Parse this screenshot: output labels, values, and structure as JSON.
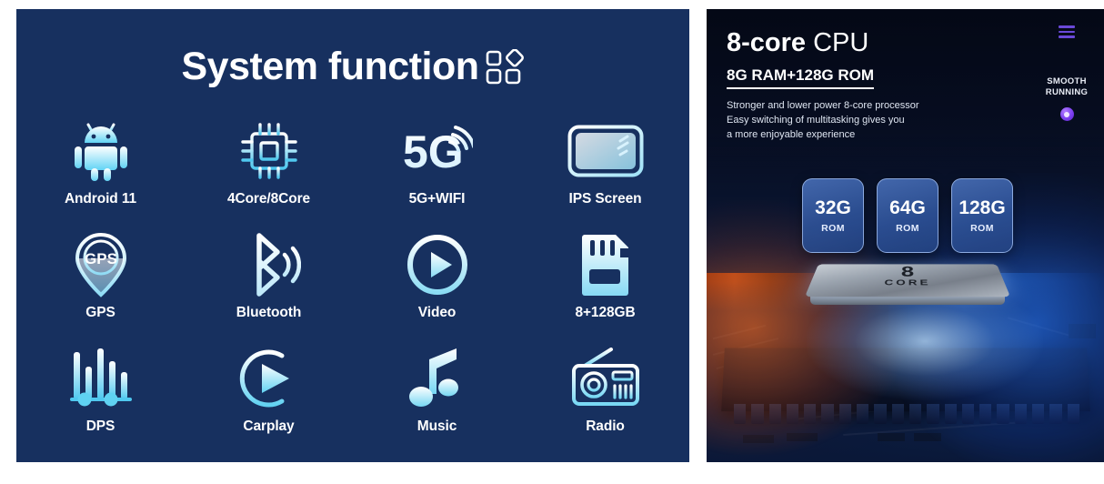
{
  "colors": {
    "left_panel_bg": "#17305f",
    "icon_light": "#ffffff",
    "icon_cyan": "#5fd2f2",
    "right_panel_bg": "#060c1c",
    "accent_purple": "#6a49d8",
    "badge_blue": "#2e5298"
  },
  "left_panel": {
    "title": "System function",
    "title_icon": "grid-diamond-icon",
    "features": [
      {
        "label": "Android 11",
        "icon": "android-robot-icon"
      },
      {
        "label": "4Core/8Core",
        "icon": "cpu-chip-icon"
      },
      {
        "label": "5G+WIFI",
        "icon": "5g-wifi-icon"
      },
      {
        "label": "IPS Screen",
        "icon": "ips-screen-icon"
      },
      {
        "label": "GPS",
        "icon": "gps-pin-icon"
      },
      {
        "label": "Bluetooth",
        "icon": "bluetooth-icon"
      },
      {
        "label": "Video",
        "icon": "video-play-icon"
      },
      {
        "label": "8+128GB",
        "icon": "sd-card-icon"
      },
      {
        "label": "DPS",
        "icon": "equalizer-icon"
      },
      {
        "label": "Carplay",
        "icon": "carplay-icon"
      },
      {
        "label": "Music",
        "icon": "music-note-icon"
      },
      {
        "label": "Radio",
        "icon": "radio-icon"
      }
    ],
    "gps_icon_text": "GPS",
    "fiveg_icon_text": "5G"
  },
  "right_panel": {
    "headline_strong": "8-core",
    "headline_rest": " CPU",
    "subheadline": "8G RAM+128G ROM",
    "body_lines": [
      "Stronger and lower power 8-core processor",
      "Easy switching of multitasking gives you",
      "a more enjoyable experience"
    ],
    "rail": {
      "menu_icon": "hamburger-menu-icon",
      "caption_line1": "SMOOTH",
      "caption_line2": "RUNNING",
      "dot_icon": "status-dot-icon"
    },
    "rom_badges": [
      {
        "value": "32G",
        "unit": "ROM"
      },
      {
        "value": "64G",
        "unit": "ROM"
      },
      {
        "value": "128G",
        "unit": "ROM"
      }
    ],
    "cpu_chip": {
      "mark_number": "8",
      "mark_text": "CORE"
    }
  }
}
